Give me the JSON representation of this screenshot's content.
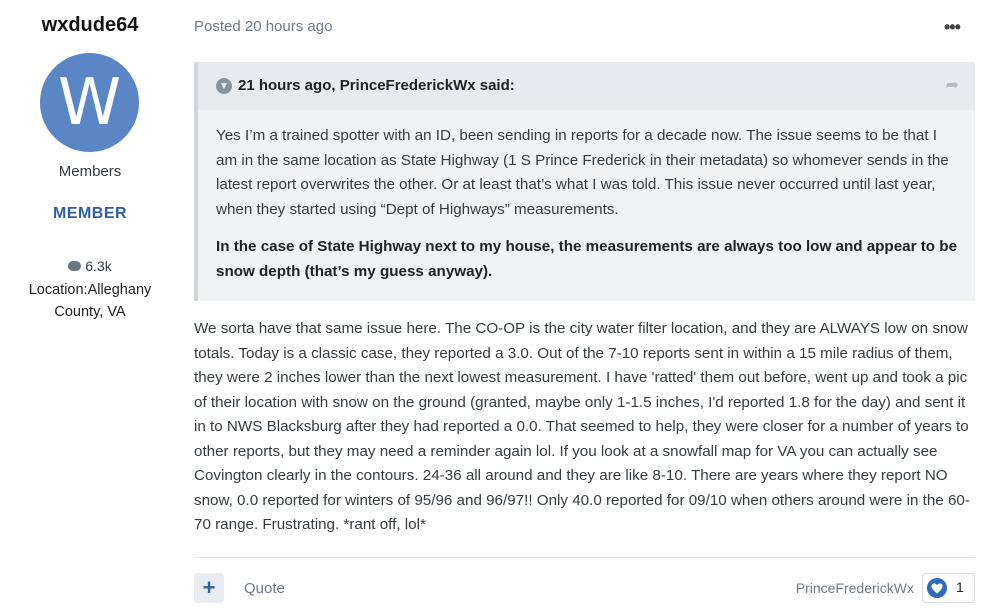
{
  "author": {
    "name": "wxdude64",
    "avatar_letter": "W",
    "avatar_color": "#5b86c5",
    "group": "Members",
    "rank": "MEMBER",
    "post_count": "6.3k",
    "location": "Location:Alleghany County, VA"
  },
  "post": {
    "posted": "Posted 20 hours ago",
    "menu_icon": "ellipsis-icon",
    "quote": {
      "cite": "21 hours ago, PrinceFrederickWx said:",
      "paragraph1": "Yes I’m a trained spotter with an ID, been sending in reports for a decade now. The issue seems to be that I am in the same location as State Highway (1 S Prince Frederick in their metadata) so whomever sends in the latest report overwrites the other. Or at least that’s what I was told. This issue never occurred until last year, when they started using “Dept of Highways” measurements.",
      "paragraph2": "In the case of State Highway next to my house, the measurements are always too low and appear to be snow depth (that’s my guess anyway)."
    },
    "body": "We sorta have that same issue here. The CO-OP is the city water filter location, and they are ALWAYS low on snow totals. Today is a classic case, they reported a 3.0. Out of the 7-10 reports sent in within a 15 mile radius of them, they were 2 inches lower than the next lowest measurement. I have 'ratted' them out before, went up and took a pic of their location with snow on the ground (granted, maybe only 1-1.5 inches, I'd reported 1.8 for the day) and sent it in to NWS Blacksburg after they had reported a 0.0. That seemed to help, they were closer for a number of years to other reports, but they may need a reminder again lol. If you look at a snowfall map for VA you can actually see Covington clearly in the contours. 24-36 all around and they are like 8-10. There are years where they report NO snow, 0.0 reported for winters of 95/96 and 96/97!! Only 40.0 reported for 09/10 when others around were in the 60-70 range. Frustrating. *rant off, lol*"
  },
  "footer": {
    "plus_label": "+",
    "quote_label": "Quote",
    "reactor": "PrinceFrederickWx",
    "reaction_count": "1",
    "reaction_icon": "heart-icon"
  },
  "colors": {
    "accent": "#2f5f9e",
    "quote_bg": "#f0f2f4",
    "reaction": "#2f6bbf"
  }
}
